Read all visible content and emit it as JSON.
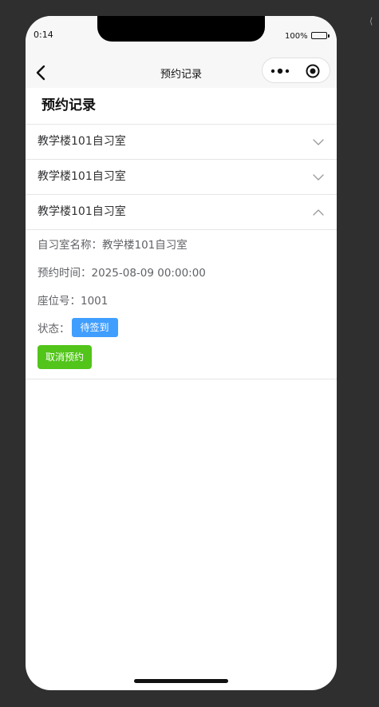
{
  "status_bar": {
    "time": "0:14",
    "battery": "100%"
  },
  "nav": {
    "title": "预约记录"
  },
  "page": {
    "title": "预约记录"
  },
  "records": [
    {
      "title": "教学楼101自习室",
      "expanded": false
    },
    {
      "title": "教学楼101自习室",
      "expanded": false
    },
    {
      "title": "教学楼101自习室",
      "expanded": true
    }
  ],
  "detail": {
    "name_label": "自习室名称：",
    "name_value": "教学楼101自习室",
    "time_label": "预约时间：",
    "time_value": "2025-08-09 00:00:00",
    "seat_label": "座位号：",
    "seat_value": "1001",
    "status_label": "状态：",
    "status_value": "待签到",
    "cancel_label": "取消预约"
  },
  "colors": {
    "status_badge": "#409eff",
    "cancel_button": "#52c41a"
  }
}
